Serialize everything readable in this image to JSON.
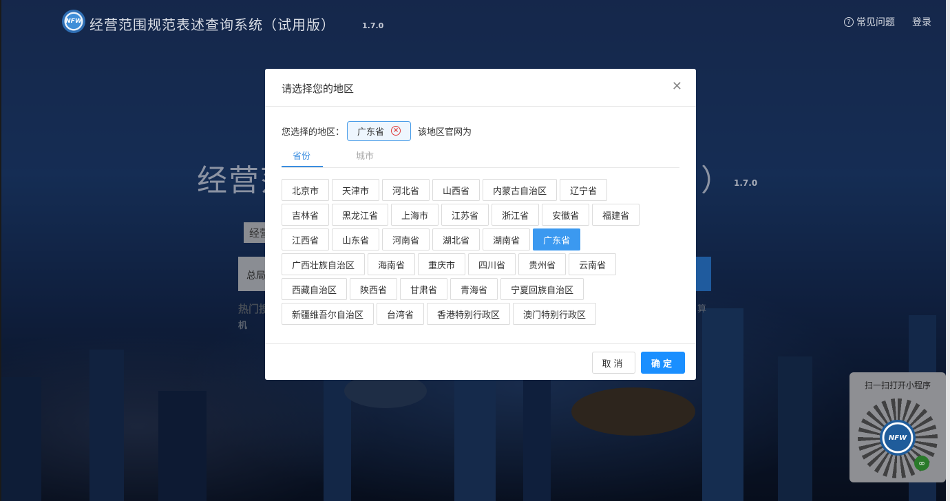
{
  "header": {
    "logo_text": "NFW",
    "app_title": "经营范围规范表述查询系统（试用版）",
    "version": "1.7.0",
    "faq_label": "常见问题",
    "login_label": "登录"
  },
  "hero": {
    "title_fragment": "经营范",
    "paren": "）",
    "version": "1.7.0",
    "scope_fragment": "经营",
    "search_fragment": "总局",
    "hot_label": "热门搜",
    "hot_more": "机",
    "hot_right": "算"
  },
  "qr": {
    "caption": "扫一扫打开小程序",
    "logo_text": "NFW"
  },
  "modal": {
    "title": "请选择您的地区",
    "selected_label": "您选择的地区：",
    "selected_value": "广东省",
    "site_label": "该地区官网为",
    "tabs": [
      "省份",
      "城市"
    ],
    "rows": [
      [
        "北京市",
        "天津市",
        "河北省",
        "山西省",
        "内蒙古自治区",
        "辽宁省"
      ],
      [
        "吉林省",
        "黑龙江省",
        "上海市",
        "江苏省",
        "浙江省",
        "安徽省",
        "福建省"
      ],
      [
        "江西省",
        "山东省",
        "河南省",
        "湖北省",
        "湖南省",
        "广东省"
      ],
      [
        "广西壮族自治区",
        "海南省",
        "重庆市",
        "四川省",
        "贵州省",
        "云南省"
      ],
      [
        "西藏自治区",
        "陕西省",
        "甘肃省",
        "青海省",
        "宁夏回族自治区"
      ],
      [
        "新疆维吾尔自治区",
        "台湾省",
        "香港特别行政区",
        "澳门特别行政区"
      ]
    ],
    "active_option": "广东省",
    "cancel_label": "取消",
    "ok_label": "确定"
  }
}
